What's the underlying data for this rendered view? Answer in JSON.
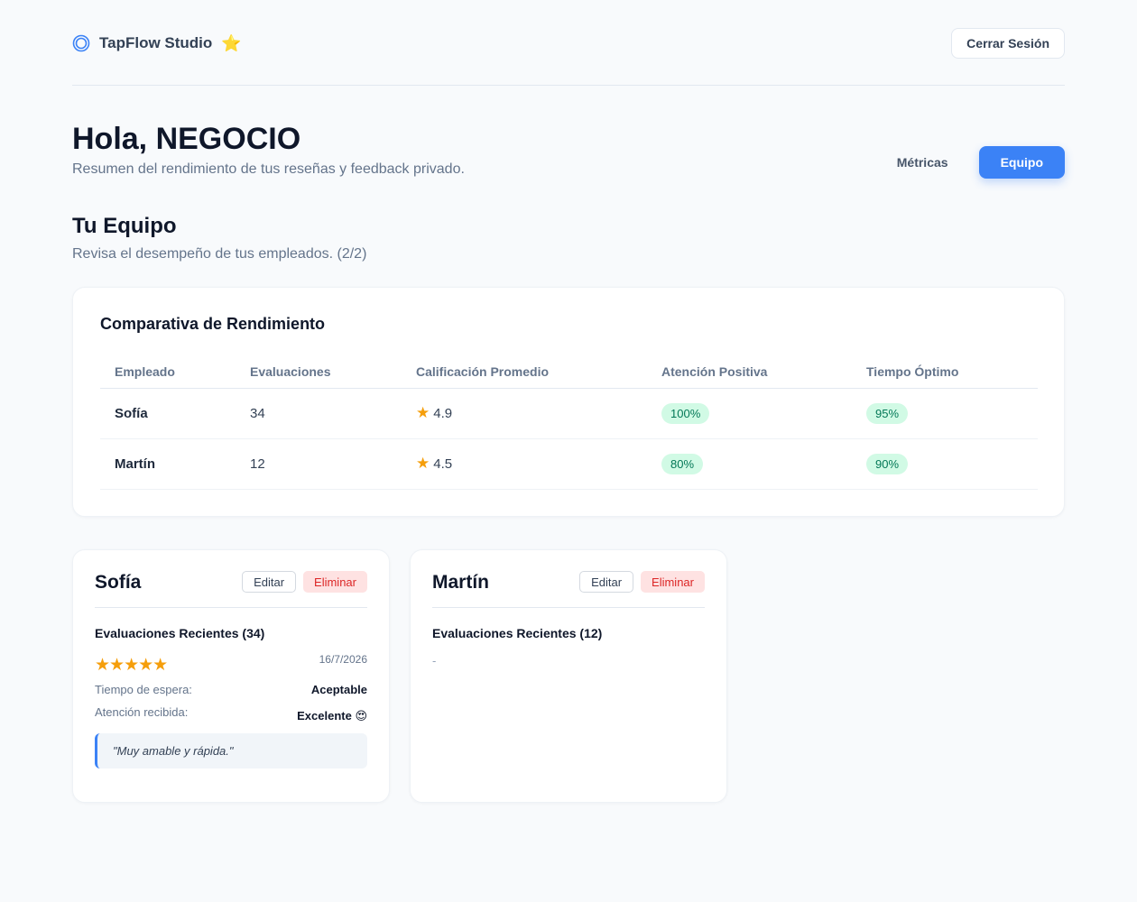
{
  "header": {
    "brand_name": "TapFlow Studio",
    "brand_badge": "⭐",
    "logout_label": "Cerrar Sesión"
  },
  "greeting": {
    "title": "Hola, NEGOCIO",
    "subtitle": "Resumen del rendimiento de tus reseñas y feedback privado."
  },
  "tabs": [
    {
      "label": "Métricas",
      "active": false
    },
    {
      "label": "Equipo",
      "active": true
    }
  ],
  "team": {
    "title": "Tu Equipo",
    "subtitle": "Revisa el desempeño de tus empleados. (2/2)"
  },
  "comparison": {
    "title": "Comparativa de Rendimiento",
    "columns": [
      "Empleado",
      "Evaluaciones",
      "Calificación Promedio",
      "Atención Positiva",
      "Tiempo Óptimo"
    ],
    "rows": [
      {
        "name": "Sofía",
        "evaluations": "34",
        "rating": "4.9",
        "positive": "100%",
        "optimal": "95%"
      },
      {
        "name": "Martín",
        "evaluations": "12",
        "rating": "4.5",
        "positive": "80%",
        "optimal": "90%"
      }
    ]
  },
  "employees": [
    {
      "name": "Sofía",
      "edit_label": "Editar",
      "delete_label": "Eliminar",
      "recent_title": "Evaluaciones Recientes (34)",
      "review": {
        "stars": "★★★★★",
        "date": "16/7/2026",
        "wait_label": "Tiempo de espera:",
        "wait_value": "Aceptable",
        "attention_label": "Atención recibida:",
        "attention_value": "Excelente 😍",
        "comment": "\"Muy amable y rápida.\""
      }
    },
    {
      "name": "Martín",
      "edit_label": "Editar",
      "delete_label": "Eliminar",
      "recent_title": "Evaluaciones Recientes (12)",
      "empty_text": "-"
    }
  ],
  "colors": {
    "accent": "#3b82f6",
    "star": "#f59e0b",
    "pill_bg": "#d1fae5",
    "pill_text": "#047857",
    "danger_bg": "#fee2e2",
    "danger_text": "#dc2626"
  },
  "icons": {
    "brand": "target-circle-icon",
    "star": "star-icon"
  }
}
